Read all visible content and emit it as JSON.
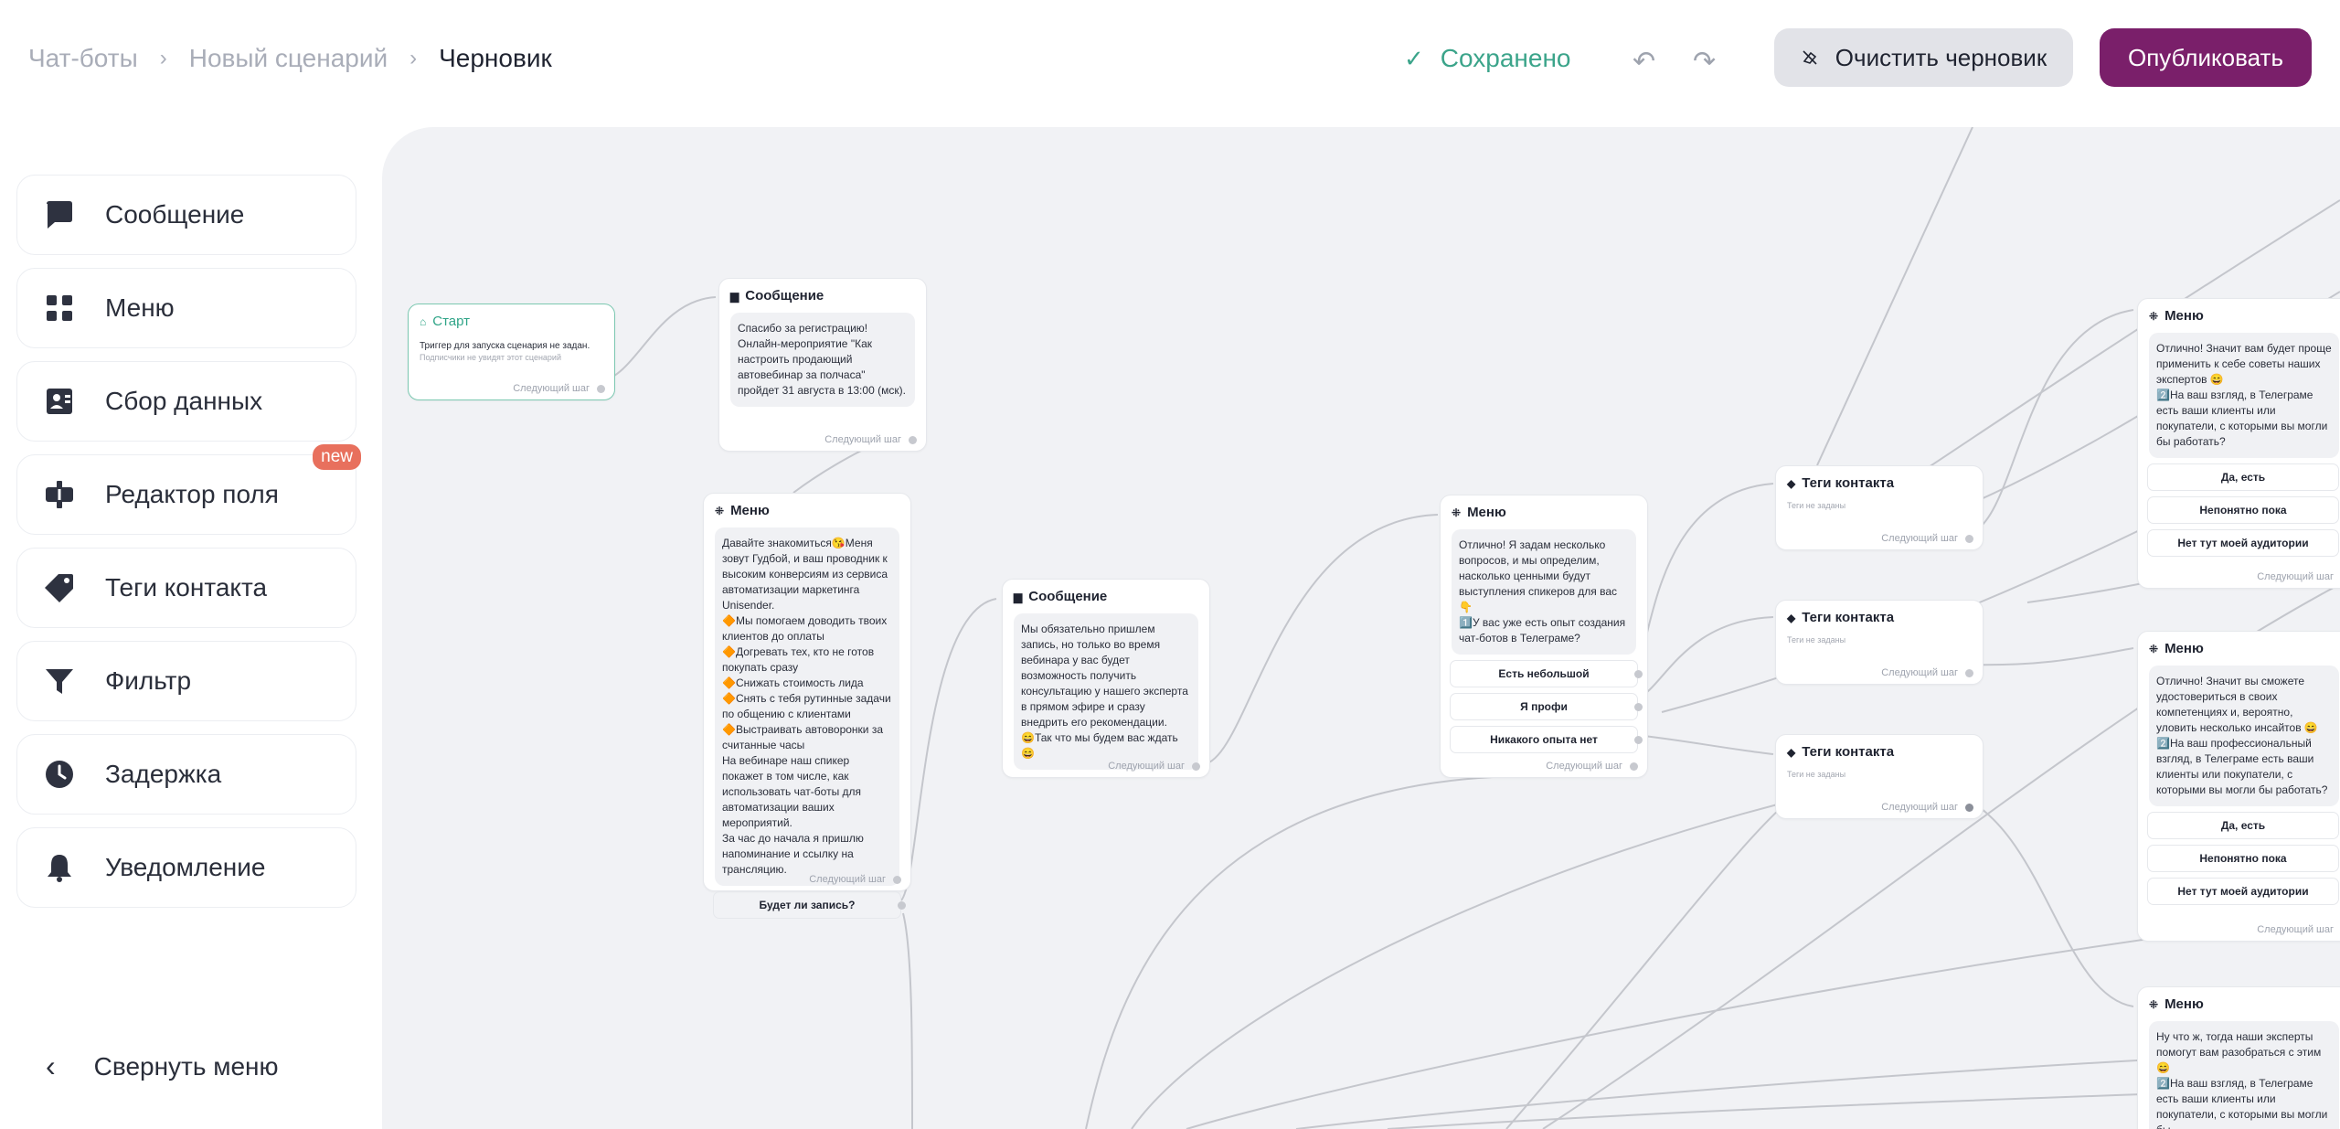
{
  "breadcrumb": {
    "items": [
      "Чат-боты",
      "Новый сценарий"
    ],
    "current": "Черновик"
  },
  "header": {
    "saved_status": "Сохранено",
    "clear_label": "Очистить черновик",
    "publish_label": "Опубликовать",
    "publish_color": "#7a1f6a",
    "saved_color": "#3ba48a"
  },
  "sidebar": {
    "items": [
      {
        "label": "Сообщение",
        "icon": "message-icon"
      },
      {
        "label": "Меню",
        "icon": "menu-grid-icon"
      },
      {
        "label": "Сбор данных",
        "icon": "contact-card-icon"
      },
      {
        "label": "Редактор поля",
        "icon": "field-editor-icon",
        "badge": "new"
      },
      {
        "label": "Теги контакта",
        "icon": "tag-icon"
      },
      {
        "label": "Фильтр",
        "icon": "filter-icon"
      },
      {
        "label": "Задержка",
        "icon": "clock-icon"
      },
      {
        "label": "Уведомление",
        "icon": "bell-icon"
      }
    ],
    "collapse_label": "Свернуть меню"
  },
  "canvas": {
    "start": {
      "title": "Старт",
      "text": "Триггер для запуска сценария не задан.",
      "subtext": "Подписчики не увидят этот сценарий",
      "next": "Следующий шаг"
    },
    "msg1": {
      "title": "Сообщение",
      "body": "Спасибо за регистрацию!\nОнлайн-мероприятие \"Как настроить продающий автовебинар за полчаса\" пройдет 31 августа в 13:00 (мск).",
      "next": "Следующий шаг"
    },
    "menu1": {
      "title": "Меню",
      "body": "Давайте знакомиться😘Меня зовут Гудбой, и ваш проводник к высоким конверсиям из сервиса автоматизации маркетинга Unisender.\n🔶Мы помогаем доводить твоих клиентов до оплаты\n🔶Догревать тех, кто не готов покупать сразу\n🔶Снижать стоимость лида\n🔶Снять с тебя рутинные задачи по общению с клиентами\n🔶Выстраивать автоворонки за считанные часы\nНа вебинаре наш спикер покажет в том числе, как использовать чат-боты для автоматизации ваших мероприятий.\nЗа час до начала я пришлю напоминание и ссылку на трансляцию.",
      "options": [
        "Будет ли запись?"
      ],
      "next": "Следующий шаг"
    },
    "msg2": {
      "title": "Сообщение",
      "body": "Мы обязательно пришлем запись, но только во время вебинара у вас будет возможность получить консультацию у нашего эксперта в прямом эфире и сразу внедрить его рекомендации.\n😄Так что мы будем вас ждать 😄",
      "next": "Следующий шаг"
    },
    "menu2": {
      "title": "Меню",
      "body": "Отлично! Я задам несколько вопросов, и мы определим, насколько ценными будут выступления спикеров для вас 👇\n1️⃣У вас уже есть опыт создания чат-ботов в Телеграме?",
      "options": [
        "Есть небольшой",
        "Я профи",
        "Никакого опыта нет"
      ],
      "next": "Следующий шаг"
    },
    "tags": [
      {
        "title": "Теги контакта",
        "subtitle": "Теги не заданы",
        "next": "Следующий шаг"
      },
      {
        "title": "Теги контакта",
        "subtitle": "Теги не заданы",
        "next": "Следующий шаг"
      },
      {
        "title": "Теги контакта",
        "subtitle": "Теги не заданы",
        "next": "Следующий шаг"
      }
    ],
    "menu3": {
      "title": "Меню",
      "body": "Отлично! Значит вам будет проще применить к себе советы наших экспертов 😄\n2️⃣На ваш взгляд, в Телеграме есть ваши клиенты или покупатели, с которыми вы могли бы работать?",
      "options": [
        "Да, есть",
        "Непонятно пока",
        "Нет тут моей аудитории"
      ],
      "next": "Следующий шаг"
    },
    "menu4": {
      "title": "Меню",
      "body": "Отлично! Значит вы сможете удостовериться в своих компетенциях и, вероятно, уловить несколько инсайтов 😄\n2️⃣На ваш профессиональный взгляд, в Телеграме есть ваши клиенты или покупатели, с которыми вы могли бы работать?",
      "options": [
        "Да, есть",
        "Непонятно пока",
        "Нет тут моей аудитории"
      ],
      "next": "Следующий шаг"
    },
    "menu5": {
      "title": "Меню",
      "body": "Ну что ж, тогда наши эксперты помогут вам разобраться с этим 😄\n2️⃣На ваш взгляд, в Телеграме есть ваши клиенты или покупатели, с которыми вы могли бы"
    }
  }
}
